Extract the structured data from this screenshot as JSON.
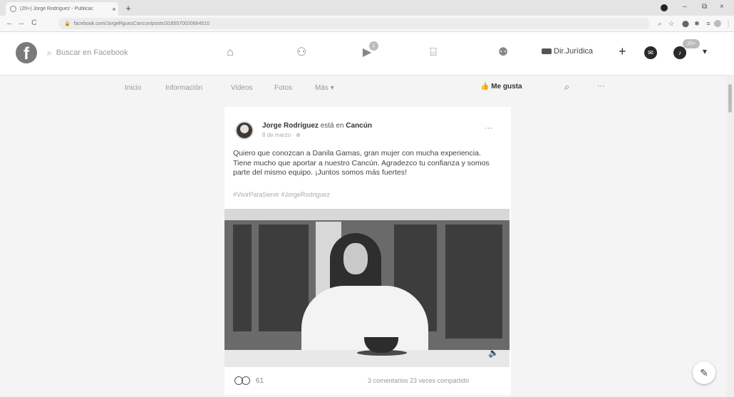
{
  "browser": {
    "tab_title": "(20+) Jorge Rodríguez - Publicac",
    "tab_close": "×",
    "new_tab": "+",
    "url": "facebook.com/JorgeRguezCancun/posts/3185570020664510",
    "minimize": "–",
    "maximize": "⧉",
    "close": "×",
    "back": "←",
    "forward": "→",
    "reload": "C"
  },
  "facebook": {
    "logo": "f",
    "search_placeholder": "Buscar en Facebook",
    "watch_badge": "1",
    "account_name": "Dir.Jurídica",
    "create": "+",
    "notifications_badge": "20+",
    "menu_caret": "▾"
  },
  "page_nav": {
    "items": [
      "Inicio",
      "Información",
      "Videos",
      "Fotos",
      "Más ▾"
    ],
    "like_label": "Me gusta",
    "like_icon": "👍",
    "more": "···"
  },
  "post": {
    "author": "Jorge Rodríguez",
    "location_prefix": "está en",
    "location": "Cancún",
    "date": "8 de marzo · ",
    "globe": "⊕",
    "dots": "···",
    "text": "Quiero que conozcan a Danila Gamas, gran mujer con mucha experiencia. Tiene mucho que aportar a nuestro Cancún. Agradezco tu confianza y somos parte del mismo equipo. ¡Juntos somos más fuertes!",
    "hashtags": "#VivirParaServir #JorgeRodriguez",
    "reactions_count": "61",
    "comments_shares": "3 comentarios 23 veces compartido",
    "volume_icon": "🔈"
  },
  "compose_icon": "✎"
}
